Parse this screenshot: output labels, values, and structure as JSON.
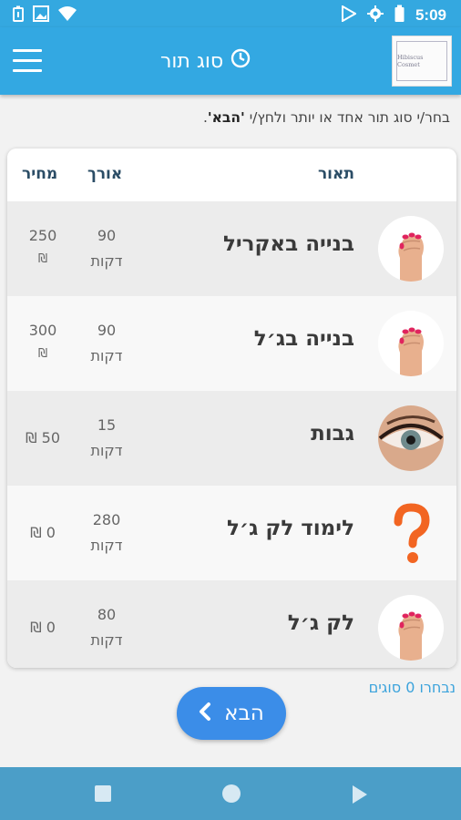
{
  "status_bar": {
    "time": "5:09",
    "icons": [
      "battery-saver-icon",
      "image-icon",
      "wifi-icon",
      "play-store-icon",
      "settings-icon",
      "battery-icon"
    ]
  },
  "app_bar": {
    "title": "סוג תור",
    "title_icon": "clock-icon",
    "menu_icon": "hamburger-icon",
    "logo_text": "Hibiscus Cosmet"
  },
  "instruction": {
    "text_before": "בחר/י סוג תור אחד או יותר ולחץ/י ",
    "bold": "'הבא'",
    "text_after": "."
  },
  "table": {
    "headers": {
      "description": "תאור",
      "length": "אורך",
      "price": "מחיר"
    },
    "rows": [
      {
        "name": "בנייה באקריל",
        "length": "90",
        "length_unit": "דקות",
        "price": "250",
        "currency": "₪",
        "image": "nails-hand-icon"
      },
      {
        "name": "בנייה בג׳ל",
        "length": "90",
        "length_unit": "דקות",
        "price": "300",
        "currency": "₪",
        "image": "nails-hand-icon"
      },
      {
        "name": "גבות",
        "length": "15",
        "length_unit": "דקות",
        "price": "₪ 50",
        "image": "eye-icon"
      },
      {
        "name": "לימוד לק ג׳ל",
        "length": "280",
        "length_unit": "דקות",
        "price": "₪ 0",
        "image": "question-mark-icon"
      },
      {
        "name": "לק ג׳ל",
        "length": "80",
        "length_unit": "דקות",
        "price": "₪ 0",
        "image": "nails-hand-icon"
      }
    ]
  },
  "selection": {
    "count_text": "נבחרו 0 סוגים"
  },
  "next_button": {
    "label": "הבא",
    "icon": "chevron-left-icon"
  },
  "colors": {
    "app_bar": "#33a8e2",
    "button": "#3b8de8",
    "nav_bar": "#4b9ec8",
    "question_mark": "#f26522"
  }
}
